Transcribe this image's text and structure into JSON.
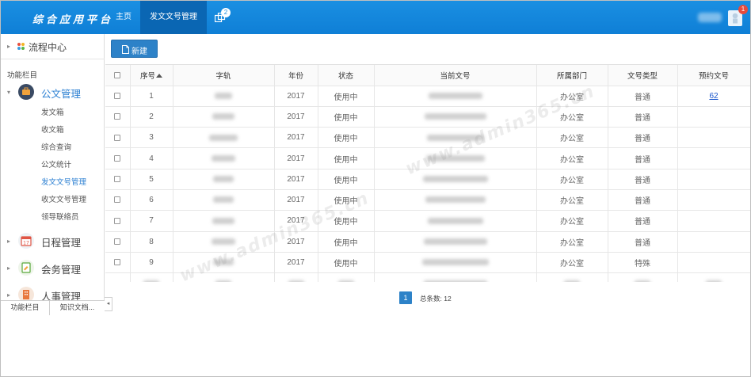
{
  "app": {
    "title": "综合应用平台",
    "nav": [
      {
        "label": "主页"
      },
      {
        "label": "发文文号管理"
      }
    ],
    "nav_extra_badge": "2",
    "notification_badge": "1",
    "brand_color": "#1a8fe2"
  },
  "sidebar": {
    "flow_center": "流程中心",
    "func_title": "功能栏目",
    "modules": [
      {
        "label": "公文管理",
        "icon": "briefcase-icon",
        "color": "#3a4a63"
      },
      {
        "label": "日程管理",
        "icon": "calendar-icon",
        "color": "#e05545"
      },
      {
        "label": "会务管理",
        "icon": "clipboard-icon",
        "color": "#57a639"
      },
      {
        "label": "人事管理",
        "icon": "building-icon",
        "color": "#e8773c"
      }
    ],
    "sub_items": [
      {
        "label": "发文箱"
      },
      {
        "label": "收文箱"
      },
      {
        "label": "综合查询"
      },
      {
        "label": "公文统计"
      },
      {
        "label": "发文文号管理"
      },
      {
        "label": "收文文号管理"
      },
      {
        "label": "领导联络员"
      }
    ],
    "bottom_tabs": [
      {
        "label": "功能栏目"
      },
      {
        "label": "知识文档..."
      }
    ]
  },
  "toolbar": {
    "new_label": "新建"
  },
  "grid": {
    "columns": [
      "序号",
      "字轨",
      "年份",
      "状态",
      "当前文号",
      "所属部门",
      "文号类型",
      "预约文号"
    ],
    "rows": [
      {
        "no": "1",
        "year": "2017",
        "status": "使用中",
        "dept": "办公室",
        "type": "普通",
        "reserved": "62"
      },
      {
        "no": "2",
        "year": "2017",
        "status": "使用中",
        "dept": "办公室",
        "type": "普通",
        "reserved": ""
      },
      {
        "no": "3",
        "year": "2017",
        "status": "使用中",
        "dept": "办公室",
        "type": "普通",
        "reserved": ""
      },
      {
        "no": "4",
        "year": "2017",
        "status": "使用中",
        "dept": "办公室",
        "type": "普通",
        "reserved": ""
      },
      {
        "no": "5",
        "year": "2017",
        "status": "使用中",
        "dept": "办公室",
        "type": "普通",
        "reserved": ""
      },
      {
        "no": "6",
        "year": "2017",
        "status": "使用中",
        "dept": "办公室",
        "type": "普通",
        "reserved": ""
      },
      {
        "no": "7",
        "year": "2017",
        "status": "使用中",
        "dept": "办公室",
        "type": "普通",
        "reserved": ""
      },
      {
        "no": "8",
        "year": "2017",
        "status": "使用中",
        "dept": "办公室",
        "type": "普通",
        "reserved": ""
      },
      {
        "no": "9",
        "year": "2017",
        "status": "使用中",
        "dept": "办公室",
        "type": "特殊",
        "reserved": ""
      }
    ]
  },
  "pager": {
    "page": "1",
    "total_label": "总条数: 12"
  },
  "watermark": "www.admin365.cn"
}
